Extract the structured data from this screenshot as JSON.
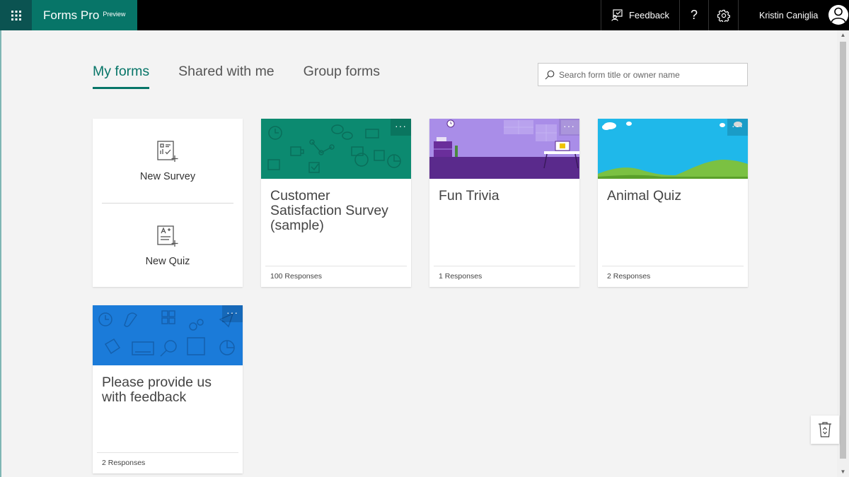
{
  "app": {
    "name": "Forms Pro",
    "tag": "Preview"
  },
  "topbar": {
    "feedback_label": "Feedback",
    "help_label": "?",
    "user_name": "Kristin Caniglia"
  },
  "tabs": [
    {
      "label": "My forms",
      "active": true
    },
    {
      "label": "Shared with me",
      "active": false
    },
    {
      "label": "Group forms",
      "active": false
    }
  ],
  "search": {
    "placeholder": "Search form title or owner name"
  },
  "new_actions": {
    "survey_label": "New Survey",
    "quiz_label": "New Quiz"
  },
  "forms": [
    {
      "title": "Customer Satisfaction Survey (sample)",
      "responses": "100 Responses",
      "theme": "green",
      "more": "···"
    },
    {
      "title": "Fun Trivia",
      "responses": "1 Responses",
      "theme": "purple",
      "more": "···"
    },
    {
      "title": "Animal Quiz",
      "responses": "2 Responses",
      "theme": "sky",
      "more": "···"
    },
    {
      "title": "Please provide us with feedback",
      "responses": "2 Responses",
      "theme": "blue",
      "more": "···"
    }
  ],
  "colors": {
    "brand": "#077568",
    "brand_dark": "#0b5351",
    "green_banner": "#0c8a70",
    "purple_banner": "#a98de8",
    "sky_banner": "#1fb8ea",
    "blue_banner": "#1b7bd9"
  }
}
